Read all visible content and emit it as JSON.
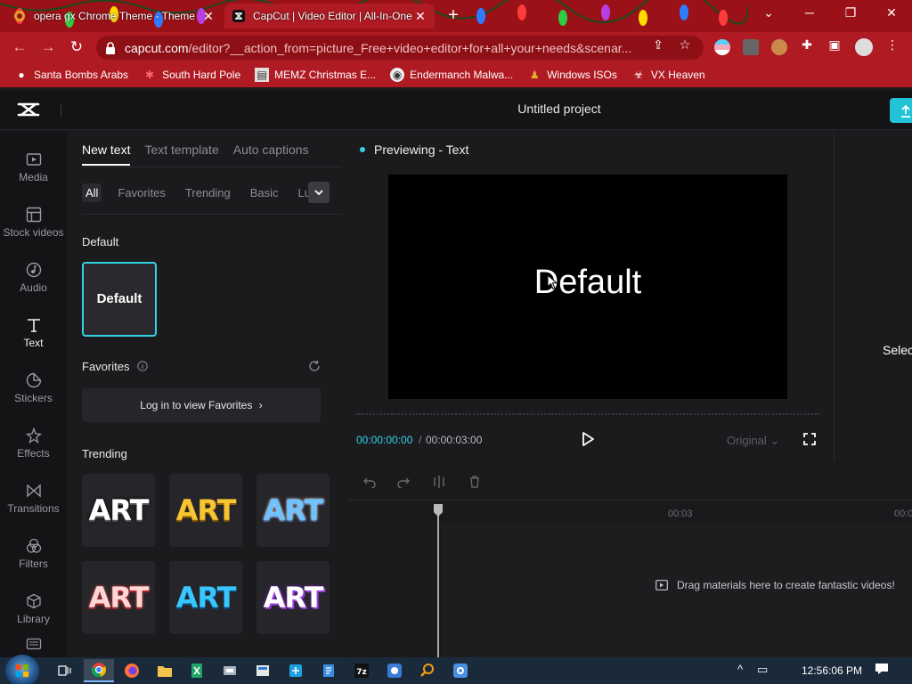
{
  "browser": {
    "tabs": [
      {
        "title": "opera gx Chrome Theme - Theme",
        "active": false
      },
      {
        "title": "CapCut | Video Editor | All-In-One",
        "active": true
      }
    ],
    "url_host": "capcut.com",
    "url_path": "/editor?__action_from=picture_Free+video+editor+for+all+your+needs&scenar...",
    "bookmarks": [
      "Santa Bombs Arabs",
      "South Hard Pole",
      "MEMZ Christmas E...",
      "Endermanch Malwa...",
      "Windows ISOs",
      "VX Heaven"
    ],
    "accent_color": "#b01a22"
  },
  "app": {
    "project_title": "Untitled project",
    "accent_color": "#2fd3e3",
    "nav": [
      {
        "label": "Media",
        "icon": "media-icon",
        "active": false
      },
      {
        "label": "Stock videos",
        "icon": "stock-videos-icon",
        "active": false
      },
      {
        "label": "Audio",
        "icon": "audio-icon",
        "active": false
      },
      {
        "label": "Text",
        "icon": "text-icon",
        "active": true
      },
      {
        "label": "Stickers",
        "icon": "stickers-icon",
        "active": false
      },
      {
        "label": "Effects",
        "icon": "effects-icon",
        "active": false
      },
      {
        "label": "Transitions",
        "icon": "transitions-icon",
        "active": false
      },
      {
        "label": "Filters",
        "icon": "filters-icon",
        "active": false
      },
      {
        "label": "Library",
        "icon": "library-icon",
        "active": false
      }
    ],
    "panel": {
      "tabs": [
        "New text",
        "Text template",
        "Auto captions"
      ],
      "filters": [
        "All",
        "Favorites",
        "Trending",
        "Basic",
        "Lu"
      ],
      "default_section": "Default",
      "default_card": "Default",
      "favorites_section": "Favorites",
      "login_label": "Log in to view Favorites",
      "trending_section": "Trending",
      "art_label": "ART"
    },
    "preview": {
      "label": "Previewing - Text",
      "canvas_text": "Default",
      "time_current": "00:00:00:00",
      "time_separator": "/",
      "time_total": "00:00:03:00",
      "ratio_label": "Original"
    },
    "inspector_text": "Selec",
    "timeline": {
      "ruler_marks": [
        "00:03",
        "00:0"
      ],
      "drag_hint": "Drag materials here to create fantastic videos!"
    }
  },
  "taskbar": {
    "clock": "12:56:06 PM"
  }
}
